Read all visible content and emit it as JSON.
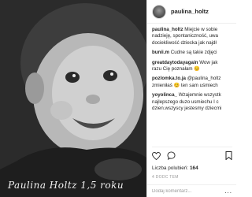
{
  "post": {
    "username": "paulina_holtz",
    "photo_caption": "Paulina Holtz   1,5 roku",
    "comments": [
      {
        "author": "paulina_holtz",
        "lines": [
          "Miejcie w sobie",
          "nadzieję, spontaniczność, uwa",
          "dociekliwość dziecka jak najdł"
        ]
      },
      {
        "author": "bunii.m",
        "lines": [
          "Cudne są takie zdjęci"
        ]
      },
      {
        "author": "greatdaytodayagain",
        "lines": [
          "Wow jak",
          "razu Cię poznałam 😊"
        ]
      },
      {
        "author": "pozlomka.to.ja",
        "lines": [
          "@paulina_holtz",
          "zmieniłaś 😊 ten sam uśmiech"
        ]
      },
      {
        "author": "yoyolinca_",
        "lines": [
          "Wzajemnie wszystk",
          "najlepszego duzo usmiechu I c",
          "dzien.wszyscy jestesmy dziecmi"
        ]
      }
    ],
    "likes_label": "Liczba polubień:",
    "likes_count": "164",
    "date": "4 DODC TEM",
    "add_comment_placeholder": "Dodaj komentarz...",
    "more_label": "..."
  },
  "icons": {
    "like": "heart-icon",
    "comment": "comment-icon",
    "save": "bookmark-icon",
    "options": "more-options-icon"
  }
}
